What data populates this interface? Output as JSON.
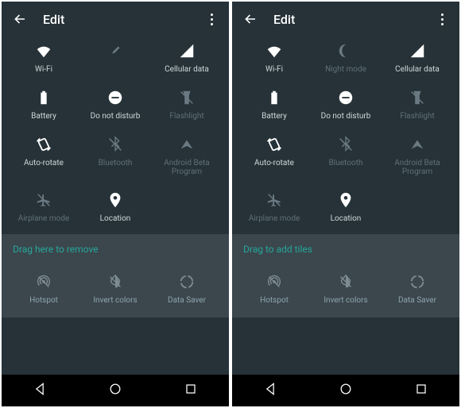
{
  "left": {
    "header": {
      "title": "Edit"
    },
    "tiles": [
      {
        "icon": "wifi",
        "label": "Wi-Fi",
        "active": true
      },
      {
        "icon": "eyedropper",
        "label": "",
        "active": false
      },
      {
        "icon": "cellular",
        "label": "Cellular data",
        "active": true
      },
      {
        "icon": "battery",
        "label": "Battery",
        "active": true
      },
      {
        "icon": "dnd",
        "label": "Do not disturb",
        "active": true
      },
      {
        "icon": "flashlight",
        "label": "Flashlight",
        "active": false
      },
      {
        "icon": "autorotate",
        "label": "Auto-rotate",
        "active": true
      },
      {
        "icon": "bluetooth",
        "label": "Bluetooth",
        "active": false
      },
      {
        "icon": "beta",
        "label": "Android Beta Program",
        "active": false
      },
      {
        "icon": "airplane",
        "label": "Airplane mode",
        "active": false
      },
      {
        "icon": "location",
        "label": "Location",
        "active": true
      }
    ],
    "hint": "Drag here to remove",
    "extra": [
      {
        "icon": "hotspot",
        "label": "Hotspot"
      },
      {
        "icon": "invert",
        "label": "Invert colors"
      },
      {
        "icon": "datasaver",
        "label": "Data Saver"
      }
    ]
  },
  "right": {
    "header": {
      "title": "Edit"
    },
    "tiles": [
      {
        "icon": "wifi",
        "label": "Wi-Fi",
        "active": true
      },
      {
        "icon": "nightmode",
        "label": "Night mode",
        "active": false
      },
      {
        "icon": "cellular",
        "label": "Cellular data",
        "active": true
      },
      {
        "icon": "battery",
        "label": "Battery",
        "active": true
      },
      {
        "icon": "dnd",
        "label": "Do not disturb",
        "active": true
      },
      {
        "icon": "flashlight",
        "label": "Flashlight",
        "active": false
      },
      {
        "icon": "autorotate",
        "label": "Auto-rotate",
        "active": true
      },
      {
        "icon": "bluetooth",
        "label": "Bluetooth",
        "active": false
      },
      {
        "icon": "beta",
        "label": "Android Beta Program",
        "active": false
      },
      {
        "icon": "airplane",
        "label": "Airplane mode",
        "active": false
      },
      {
        "icon": "location",
        "label": "Location",
        "active": true
      }
    ],
    "hint": "Drag to add tiles",
    "extra": [
      {
        "icon": "hotspot",
        "label": "Hotspot"
      },
      {
        "icon": "invert",
        "label": "Invert colors"
      },
      {
        "icon": "datasaver",
        "label": "Data Saver"
      }
    ]
  }
}
